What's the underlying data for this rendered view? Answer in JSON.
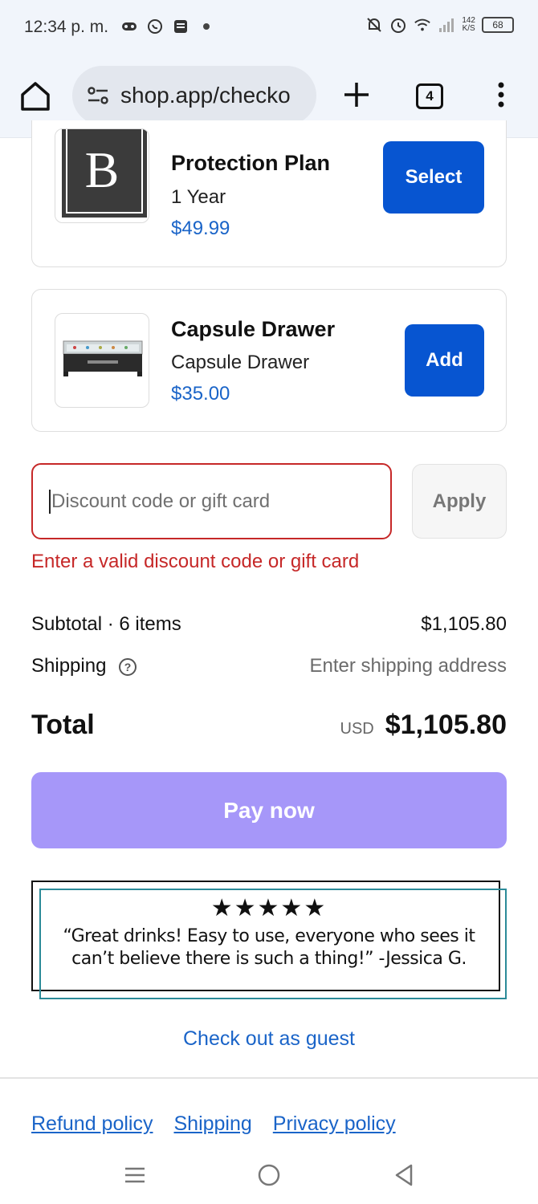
{
  "status_bar": {
    "time": "12:34 p. m.",
    "net_speed_value": "142",
    "net_speed_unit": "K/S",
    "battery": "68",
    "icons": [
      "gamepad-icon",
      "whatsapp-icon",
      "news-icon",
      "dot-icon",
      "mute-icon",
      "alarm-icon",
      "wifi-icon",
      "signal-icon",
      "battery-icon"
    ]
  },
  "browser": {
    "url": "shop.app/checko",
    "tab_count": "4"
  },
  "products": [
    {
      "name": "Protection Plan",
      "variant": "1 Year",
      "price": "$49.99",
      "button": "Select",
      "thumb_letter": "B"
    },
    {
      "name": "Capsule Drawer",
      "variant": "Capsule Drawer",
      "price": "$35.00",
      "button": "Add"
    }
  ],
  "discount": {
    "placeholder": "Discount code or gift card",
    "apply_label": "Apply",
    "error": "Enter a valid discount code or gift card"
  },
  "summary": {
    "subtotal_label": "Subtotal · 6 items",
    "subtotal_value": "$1,105.80",
    "shipping_label": "Shipping",
    "shipping_value": "Enter shipping address",
    "total_label": "Total",
    "currency": "USD",
    "total_value": "$1,105.80"
  },
  "pay_label": "Pay now",
  "review": {
    "stars": "★★★★★",
    "rating": 5,
    "line1": "“Great drinks! Easy to use, everyone who sees it",
    "line2": "can’t believe there is such a thing!” -Jessica G."
  },
  "guest_link": "Check out as guest",
  "policies": [
    "Refund policy",
    "Shipping",
    "Privacy policy"
  ],
  "colors": {
    "primary_blue": "#0755d1",
    "link_blue": "#1a64c8",
    "error_red": "#c62828",
    "pay_purple": "#a697f9"
  }
}
